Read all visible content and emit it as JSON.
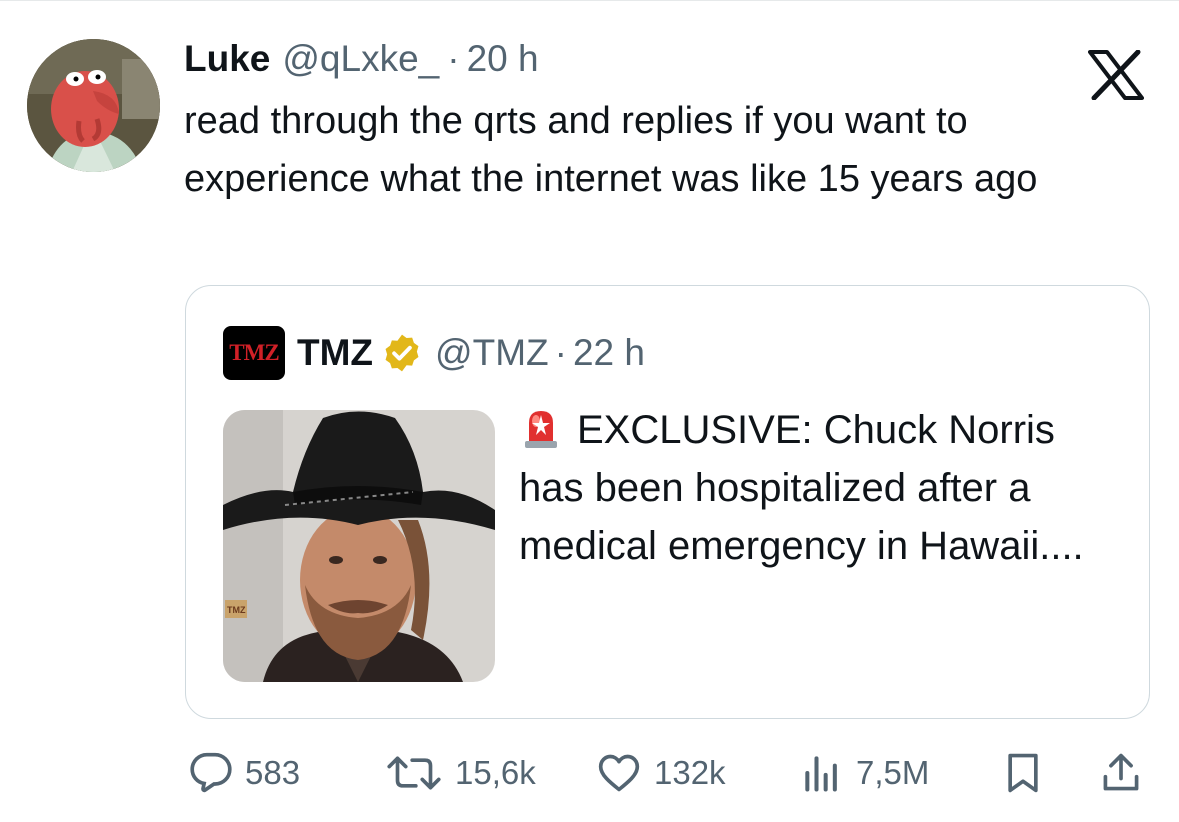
{
  "tweet": {
    "author_name": "Luke",
    "author_handle": "@qLxke_",
    "separator": "·",
    "time": "20 h",
    "text": "read through the qrts and replies if you want to experience what the internet was like 15 years ago"
  },
  "quote": {
    "logo_text": "TMZ",
    "author_name": "TMZ",
    "author_handle": "@TMZ",
    "separator": "·",
    "time": "22 h",
    "text": "EXCLUSIVE: Chuck Norris has been hospitalized after a medical emergency in Hawaii....",
    "image_watermark": "TMZ"
  },
  "actions": {
    "replies": "583",
    "reposts": "15,6k",
    "likes": "132k",
    "views": "7,5M"
  },
  "colors": {
    "text": "#0f1419",
    "secondary": "#536471",
    "border": "#cfd9de",
    "verified": "#e2b719",
    "tmz_red": "#d12027"
  },
  "icons": {
    "platform": "x-logo-icon",
    "verified": "verified-badge-icon",
    "siren": "siren-emoji-icon",
    "reply": "reply-icon",
    "repost": "repost-icon",
    "like": "heart-icon",
    "views": "views-chart-icon",
    "bookmark": "bookmark-icon",
    "share": "share-icon"
  }
}
